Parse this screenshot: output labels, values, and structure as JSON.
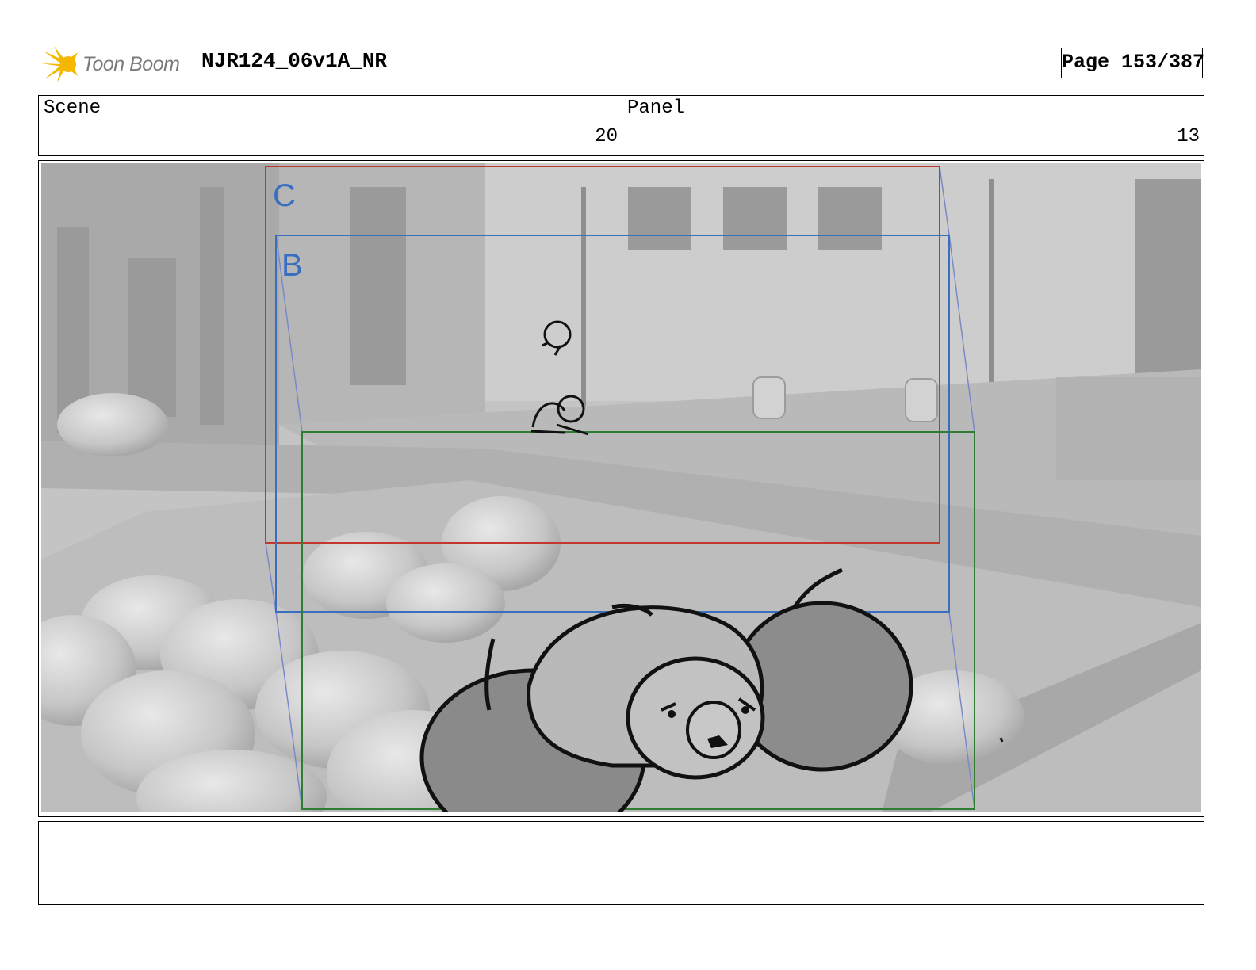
{
  "header": {
    "logo_text": "Toon Boom",
    "doc_title": "NJR124_06v1A_NR",
    "page_label": "Page 153/387"
  },
  "info": {
    "scene_label": "Scene",
    "scene_value": "20",
    "panel_label": "Panel",
    "panel_value": "13"
  },
  "frame": {
    "labels": [
      "C",
      "B"
    ],
    "colors": {
      "frame_c": "#c0392b",
      "frame_b": "#3a6fbf",
      "frame_a": "#2e7d32",
      "label": "#3a6fbf"
    }
  },
  "caption": {
    "text": ""
  }
}
